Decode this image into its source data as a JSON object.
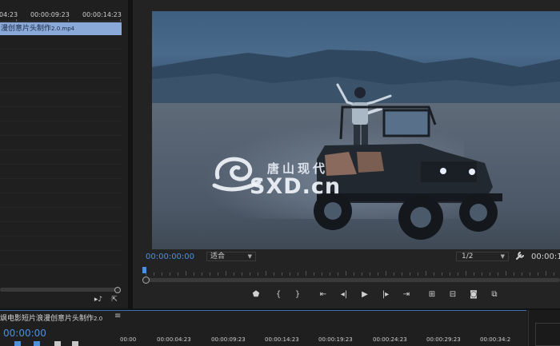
{
  "source_panel": {
    "ruler": [
      "04:23",
      "00:00:09:23",
      "00:00:14:23"
    ],
    "clip": {
      "name": "漫创意片头制作",
      "suffix": "2.0.mp4"
    }
  },
  "program_monitor": {
    "watermark": {
      "cn": "唐山现代",
      "en": "SXD.cn"
    },
    "current_timecode": "00:00:00:00",
    "fit_option": "适合",
    "resolution_option": "1/2",
    "duration_timecode": "00:00:1"
  },
  "timeline": {
    "sequence_name": "飒电影短片浪漫创意片头制作",
    "sequence_suffix": "2.0",
    "timecode": "00:00:00",
    "ruler": [
      "00:00",
      "00:00:04:23",
      "00:00:09:23",
      "00:00:14:23",
      "00:00:19:23",
      "00:00:24:23",
      "00:00:29:23",
      "00:00:34:2"
    ]
  },
  "colors": {
    "accent": "#4e8fe0",
    "clip": "#8aa8d8"
  }
}
